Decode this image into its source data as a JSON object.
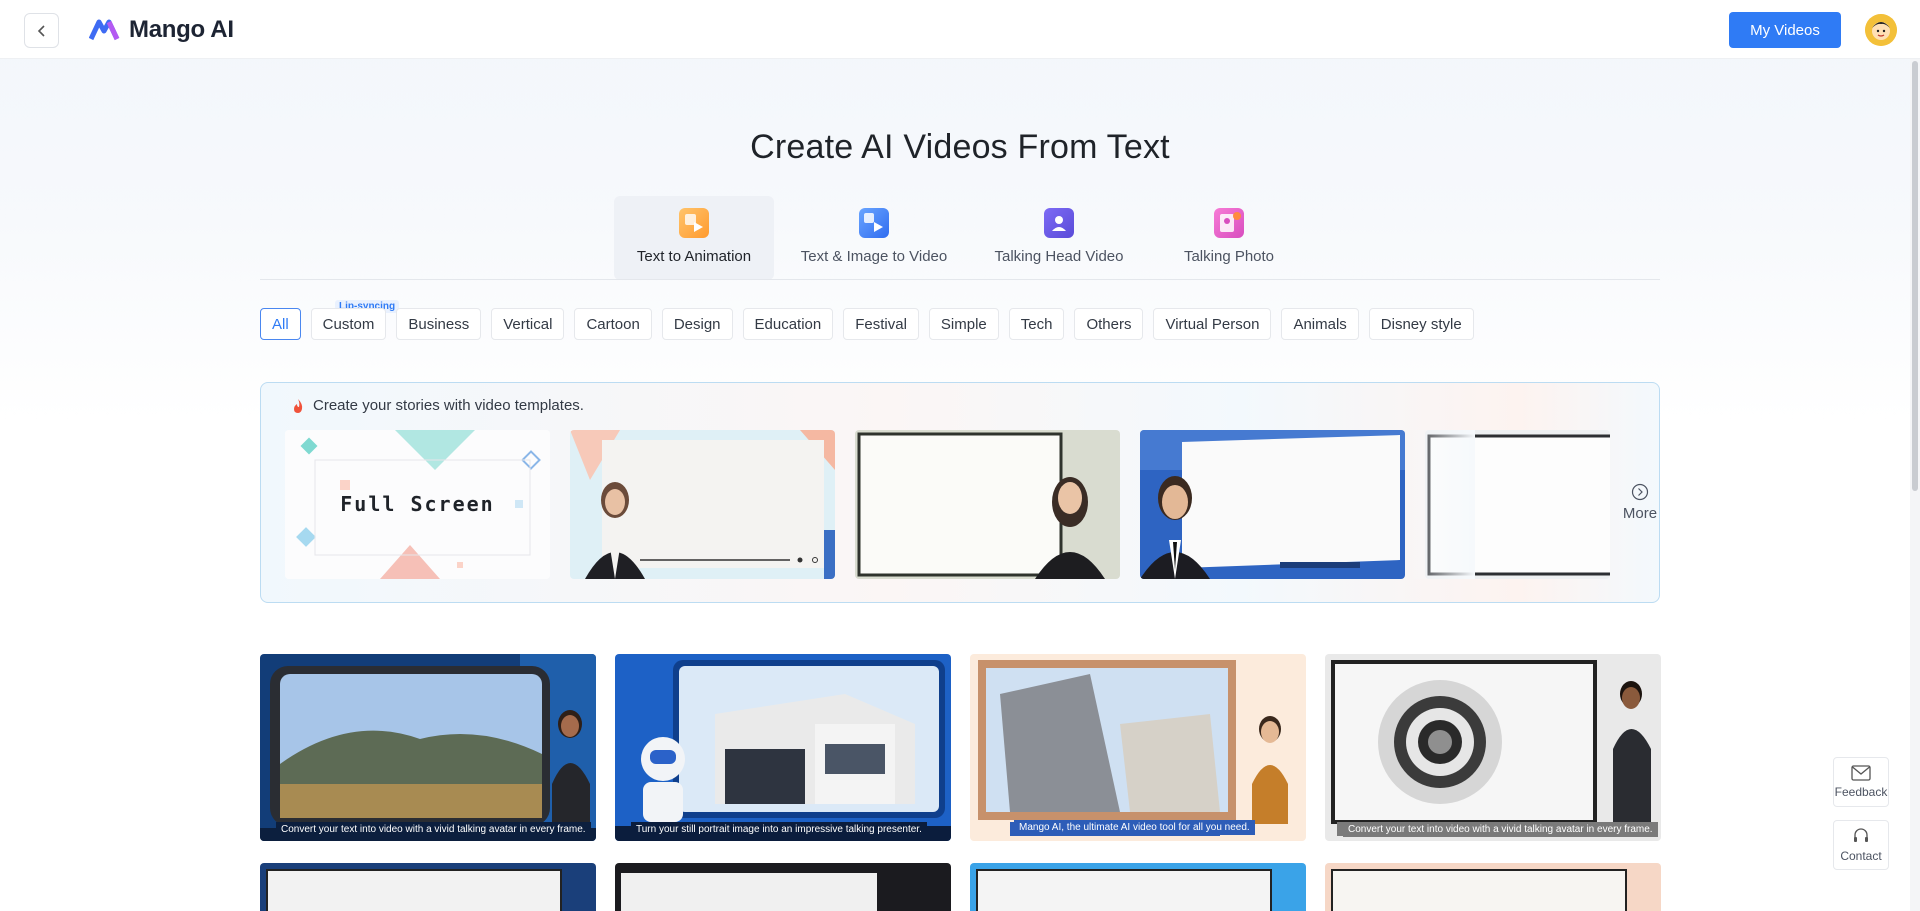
{
  "header": {
    "brand": "Mango AI",
    "my_videos": "My Videos"
  },
  "page": {
    "title": "Create AI Videos From Text"
  },
  "tabs": [
    {
      "label": "Text to Animation",
      "active": true
    },
    {
      "label": "Text & Image to Video",
      "active": false
    },
    {
      "label": "Talking Head Video",
      "active": false
    },
    {
      "label": "Talking Photo",
      "active": false
    }
  ],
  "categories": [
    {
      "label": "All",
      "active": true
    },
    {
      "label": "Custom",
      "badge": "Lip-syncing"
    },
    {
      "label": "Business"
    },
    {
      "label": "Vertical"
    },
    {
      "label": "Cartoon"
    },
    {
      "label": "Design"
    },
    {
      "label": "Education"
    },
    {
      "label": "Festival"
    },
    {
      "label": "Simple"
    },
    {
      "label": "Tech"
    },
    {
      "label": "Others"
    },
    {
      "label": "Virtual Person"
    },
    {
      "label": "Animals"
    },
    {
      "label": "Disney style"
    }
  ],
  "banner": {
    "title": "Create your stories with video templates.",
    "template_1_text": "Full Screen",
    "more": "More"
  },
  "grid": {
    "captions": [
      "Convert your text into video with a vivid talking avatar in every frame.",
      "Turn your still portrait image into an impressive talking presenter.",
      "Mango AI, the ultimate AI video tool for all you need.",
      "Convert your text into video with a vivid talking avatar in every frame."
    ]
  },
  "side": {
    "feedback": "Feedback",
    "contact": "Contact"
  },
  "colors": {
    "accent": "#2f7bf5",
    "banner_border": "#bcdcf2"
  }
}
